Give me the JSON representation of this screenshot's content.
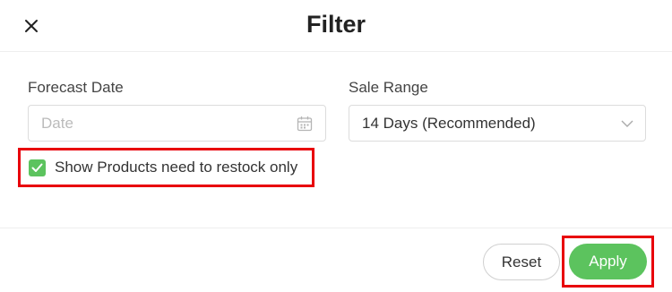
{
  "header": {
    "title": "Filter",
    "close_icon": "close-icon"
  },
  "forecast_date": {
    "label": "Forecast Date",
    "placeholder": "Date",
    "value": "",
    "icon": "calendar-icon"
  },
  "sale_range": {
    "label": "Sale Range",
    "selected": "14 Days (Recommended)",
    "icon": "chevron-down-icon"
  },
  "restock": {
    "label": "Show Products need to restock only",
    "checked": true
  },
  "footer": {
    "reset_label": "Reset",
    "apply_label": "Apply"
  },
  "colors": {
    "accent": "#5cc35e",
    "highlight": "#e8000b"
  }
}
